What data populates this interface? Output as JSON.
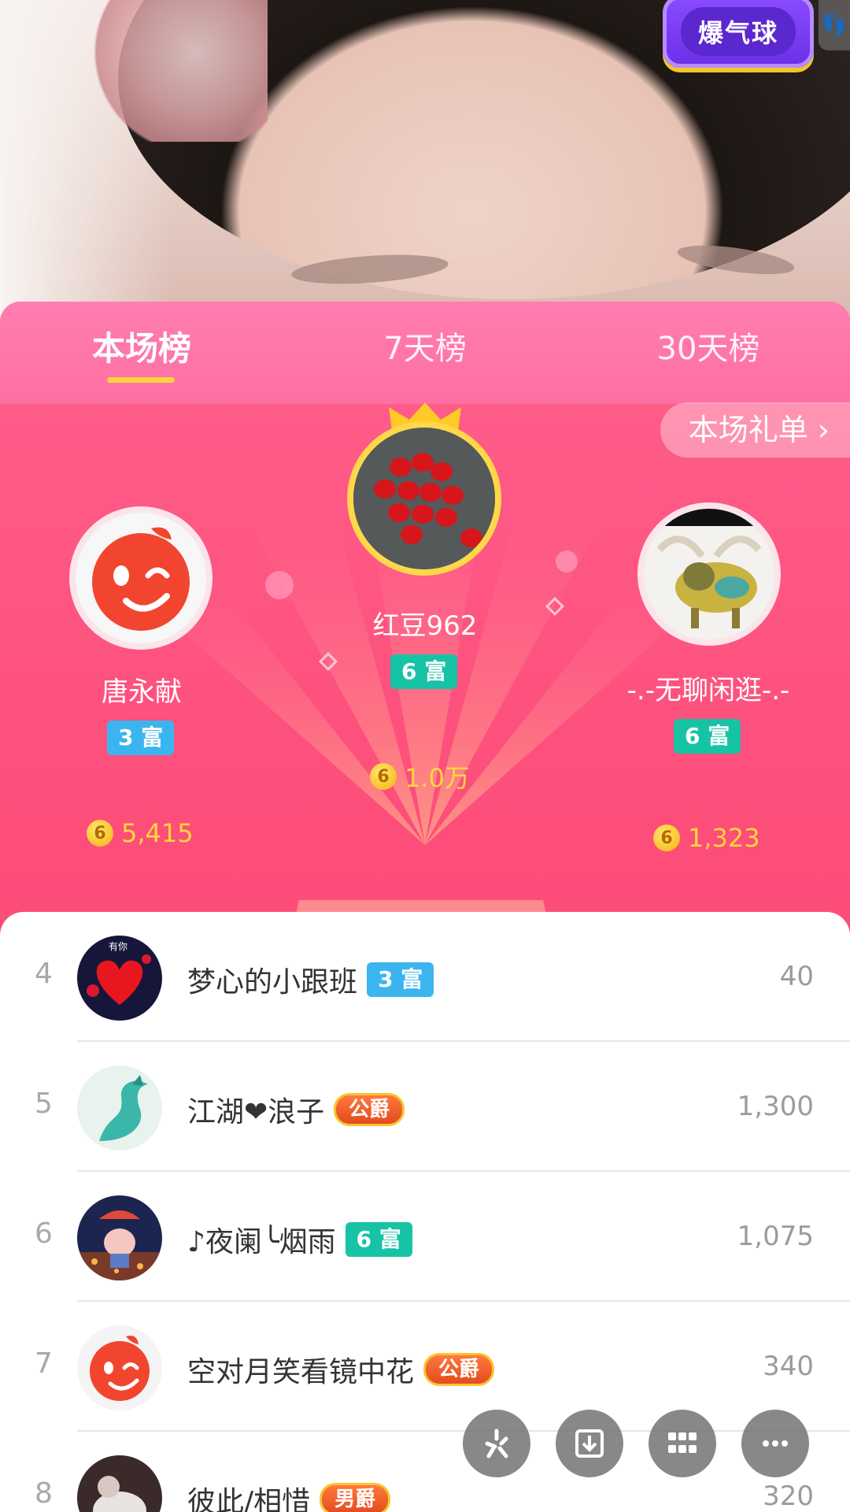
{
  "live": {
    "balloon_label": "爆气球",
    "foot_icon": "footprint-icon"
  },
  "tabs": [
    {
      "label": "本场榜",
      "active": true
    },
    {
      "label": "7天榜",
      "active": false
    },
    {
      "label": "30天榜",
      "active": false
    }
  ],
  "gift_list_label": "本场礼单 ›",
  "podium": {
    "first": {
      "rank": 1,
      "name": "红豆962",
      "badge": "6 富",
      "score": "1.0万"
    },
    "second": {
      "rank": 2,
      "name": "唐永献",
      "badge": "3 富",
      "score": "5,415"
    },
    "third": {
      "rank": 3,
      "name": "-.-无聊闲逛-.-",
      "badge": "6 富",
      "score": "1,323"
    },
    "coin_symbol": "6"
  },
  "list": [
    {
      "rank": "4",
      "name": "梦心的小跟班",
      "badge": "3 富",
      "badge_type": "blue",
      "score": "40",
      "avatar_text": "有你"
    },
    {
      "rank": "5",
      "name": "江湖❤浪子",
      "badge": "公爵",
      "badge_type": "title",
      "score": "1,300"
    },
    {
      "rank": "6",
      "name": "♪夜阑╰烟雨",
      "badge": "6 富",
      "badge_type": "teal",
      "score": "1,075"
    },
    {
      "rank": "7",
      "name": "空对月笑看镜中花",
      "badge": "公爵",
      "badge_type": "title",
      "score": "340"
    },
    {
      "rank": "8",
      "name": "彼此/相惜",
      "badge": "男爵",
      "badge_type": "title",
      "score": "320"
    }
  ],
  "tools": [
    "sparkle-icon",
    "download-icon",
    "grid-icon",
    "more-icon"
  ],
  "colors": {
    "accent_pink": "#fd4f7b",
    "gold": "#ffd83a",
    "tab_underline": "#ffd43b",
    "rich_teal": "#17c3a5",
    "rich_blue": "#3bb5f0"
  }
}
